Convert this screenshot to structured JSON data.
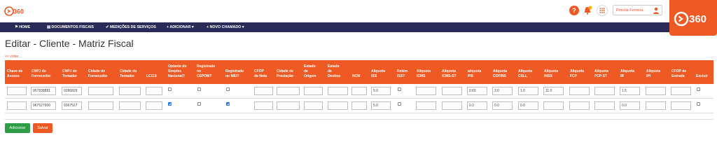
{
  "header": {
    "logo_text": "360",
    "corner_logo_text": "360",
    "user_name": "Priscila Ferreira"
  },
  "nav": {
    "items": [
      "HOME",
      "DOCUMENTOS FISCAIS",
      "MEDIÇÕES DE SERVIÇOS",
      "ADICIONAR",
      "NOVO CHAMADO"
    ]
  },
  "page": {
    "title": "Editar - Cliente - Matriz Fiscal",
    "back_link": "<< voltar"
  },
  "table": {
    "columns": [
      "Chave de\nAcesso",
      "CNPJ do\nFornecedor",
      "CNPJ do\nTomador",
      "Cidade do\nFornecedor",
      "Cidade do\nTomador",
      "LC116",
      "Optante do\nSimples\nNacional?",
      "Registrado\nno\nCEPOM?",
      "Registrado\nno MEI?",
      "CFOP\nda Nota",
      "Cidade de\nPrestação",
      "Estado\nde\nOrigem",
      "Estado\nde\nDestino",
      "NCM",
      "Aliquota\nISS",
      "Retém\nISS?",
      "Aliquota\nICMS",
      "Aliquota\nICMS-ST",
      "aliquota\nPIS",
      "Aliquota\nCOFINS",
      "Aliquota\nCSLL",
      "Aliquota\nINSS",
      "Aliquota\nFCP",
      "Aliquota\nFCP-ST",
      "Aliquota\nIR",
      "Aliquota\nIPI",
      "CFOP de\nEntrada",
      "Excluir"
    ],
    "rows": [
      {
        "chave": "",
        "cnpj_fornecedor": "957838881",
        "cnpj_tomador": "0286829",
        "cidade_fornecedor": "",
        "cidade_tomador": "",
        "lc116": "",
        "simples": false,
        "cepom": false,
        "mei": false,
        "cfop": "",
        "cidade_prestacao": "",
        "estado_origem": "",
        "estado_destino": "",
        "ncm": "",
        "iss": "5.0",
        "retem_iss": false,
        "icms": "",
        "icms_st": "",
        "pis": "0.65",
        "cofins": "3.0",
        "csll": "1.0",
        "inss": "11.0",
        "fcp": "",
        "fcp_st": "",
        "ir": "1.5",
        "ipi": "",
        "cfop_entrada": "",
        "excluir": false
      },
      {
        "chave": "",
        "cnpj_fornecedor": "967527900",
        "cnpj_tomador": "9367527",
        "cidade_fornecedor": "",
        "cidade_tomador": "",
        "lc116": "",
        "simples": true,
        "cepom": false,
        "mei": true,
        "cfop": "",
        "cidade_prestacao": "",
        "estado_origem": "",
        "estado_destino": "",
        "ncm": "",
        "iss": "5.0",
        "retem_iss": false,
        "icms": "",
        "icms_st": "",
        "pis": "0.0",
        "cofins": "0.0",
        "csll": "0.0",
        "inss": "",
        "fcp": "",
        "fcp_st": "",
        "ir": "0.0",
        "ipi": "",
        "cfop_entrada": "",
        "excluir": false
      }
    ]
  },
  "actions": {
    "add_label": "Adicionar",
    "save_label": "Salvar"
  },
  "colors": {
    "accent": "#ef5a24",
    "nav_bg": "#2b2b58",
    "add_button": "#2e9e46",
    "checkbox_checked": "#1a73e8"
  },
  "icons": [
    "help-icon",
    "bell-icon",
    "apps-grid-icon",
    "user-icon",
    "logo-360"
  ]
}
